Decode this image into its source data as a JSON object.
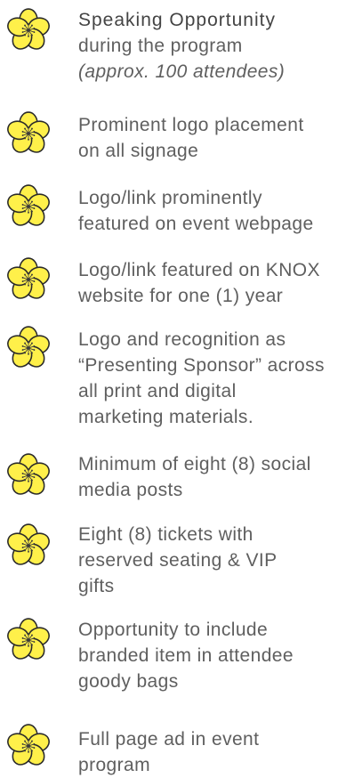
{
  "colors": {
    "petal": "#fff04a",
    "outline": "#2a2a2a",
    "center": "#3a3a3a",
    "text": "#5f5f5f",
    "heading_text": "#444444"
  },
  "icon": "yellow-flower-bullet-icon",
  "benefits": [
    {
      "lines": [
        {
          "text": "Speaking Opportunity",
          "style": "head"
        },
        {
          "text": "during the program",
          "style": "normal"
        },
        {
          "text": "(approx. 100 attendees)",
          "style": "note"
        }
      ]
    },
    {
      "lines": [
        {
          "text": "Prominent logo placement",
          "style": "normal"
        },
        {
          "text": "on all signage",
          "style": "normal"
        }
      ]
    },
    {
      "lines": [
        {
          "text": "Logo/link prominently",
          "style": "normal"
        },
        {
          "text": "featured on event webpage",
          "style": "normal"
        }
      ]
    },
    {
      "lines": [
        {
          "text": "Logo/link featured on KNOX",
          "style": "normal"
        },
        {
          "text": "website for one (1) year",
          "style": "normal"
        }
      ]
    },
    {
      "lines": [
        {
          "text": "Logo and recognition as",
          "style": "normal"
        },
        {
          "text": "“Presenting Sponsor” across",
          "style": "normal"
        },
        {
          "text": "all print and digital",
          "style": "normal"
        },
        {
          "text": "marketing materials.",
          "style": "normal"
        }
      ]
    },
    {
      "lines": [
        {
          "text": "Minimum of eight (8) social",
          "style": "normal"
        },
        {
          "text": "media posts",
          "style": "normal"
        }
      ]
    },
    {
      "lines": [
        {
          "text": "Eight (8) tickets with",
          "style": "normal"
        },
        {
          "text": "reserved seating & VIP",
          "style": "normal"
        },
        {
          "text": "gifts",
          "style": "normal"
        }
      ]
    },
    {
      "lines": [
        {
          "text": "Opportunity to include",
          "style": "normal"
        },
        {
          "text": "branded item in attendee",
          "style": "normal"
        },
        {
          "text": "goody bags",
          "style": "normal"
        }
      ]
    },
    {
      "lines": [
        {
          "text": "Full page ad in event",
          "style": "normal"
        },
        {
          "text": "program",
          "style": "normal"
        }
      ]
    }
  ]
}
